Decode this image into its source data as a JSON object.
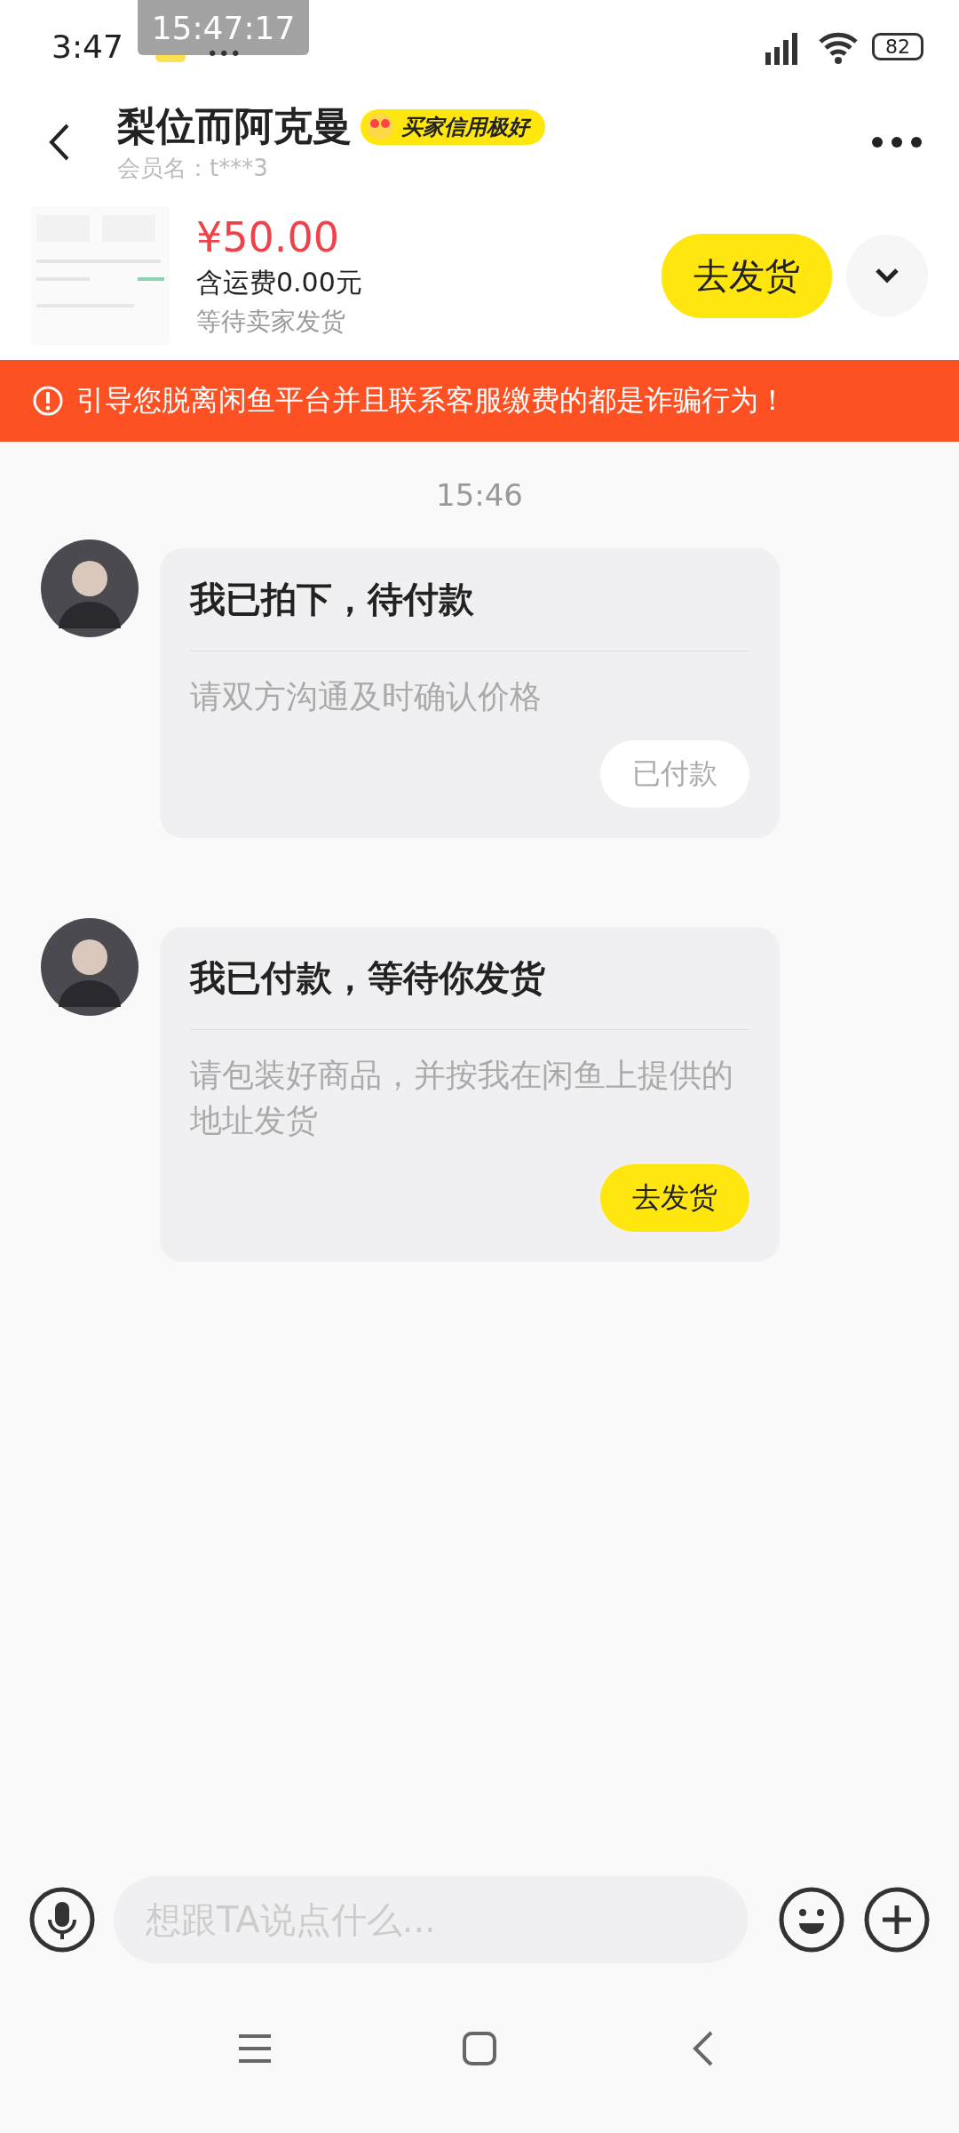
{
  "status_bar": {
    "time": "3:47",
    "overlay_clock": "15:47:17",
    "more": "•••",
    "battery": "82"
  },
  "header": {
    "name": "梨位而阿克曼",
    "badge": "买家信用极好",
    "member": "会员名：t***3"
  },
  "order": {
    "price": "¥50.00",
    "shipping": "含运费0.00元",
    "status": "等待卖家发货",
    "action": "去发货"
  },
  "warning": "引导您脱离闲鱼平台并且联系客服缴费的都是诈骗行为！",
  "chat": {
    "time": "15:46",
    "messages": [
      {
        "title": "我已拍下，待付款",
        "body": "请双方沟通及时确认价格",
        "button": "已付款",
        "primary": false
      },
      {
        "title": "我已付款，等待你发货",
        "body": "请包装好商品，并按我在闲鱼上提供的地址发货",
        "button": "去发货",
        "primary": true
      }
    ]
  },
  "composer": {
    "placeholder": "想跟TA说点什么..."
  }
}
